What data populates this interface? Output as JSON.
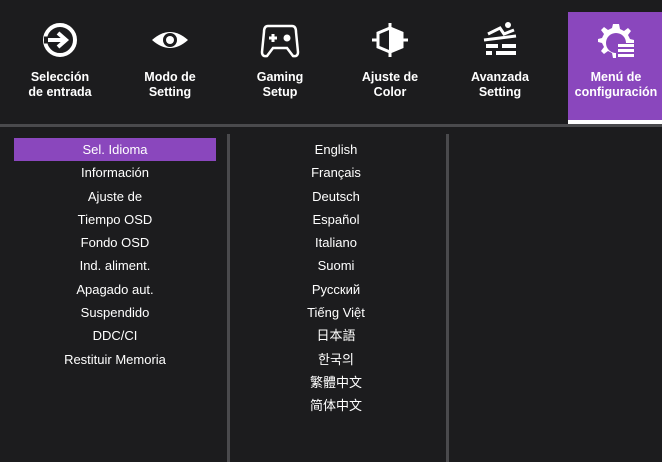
{
  "tabs": [
    {
      "label": "Selección\nde entrada",
      "icon": "input-arrow-icon",
      "active": false
    },
    {
      "label": "Modo de\nSetting",
      "icon": "eye-icon",
      "active": false
    },
    {
      "label": "Gaming\nSetup",
      "icon": "gamepad-icon",
      "active": false
    },
    {
      "label": "Ajuste de\nColor",
      "icon": "color-cube-icon",
      "active": false
    },
    {
      "label": "Avanzada\nSetting",
      "icon": "advanced-settings-icon",
      "active": false
    },
    {
      "label": "Menú de\nconfiguración",
      "icon": "gear-menu-icon",
      "active": true
    }
  ],
  "menu": {
    "items": [
      "Sel. Idioma",
      "Información",
      "Ajuste de",
      "Tiempo OSD",
      "Fondo OSD",
      "Ind. aliment.",
      "Apagado aut.",
      "Suspendido",
      "DDC/CI",
      "Restituir Memoria"
    ],
    "selected_index": 0
  },
  "languages": [
    "English",
    "Français",
    "Deutsch",
    "Español",
    "Italiano",
    "Suomi",
    "Русский",
    "Tiếng Việt",
    "日本語",
    "한국의",
    "繁體中文",
    "简体中文"
  ],
  "colors": {
    "background": "#1c1c1e",
    "accent": "#8a47bd",
    "divider": "#4a4a4d",
    "text": "#ffffff"
  }
}
